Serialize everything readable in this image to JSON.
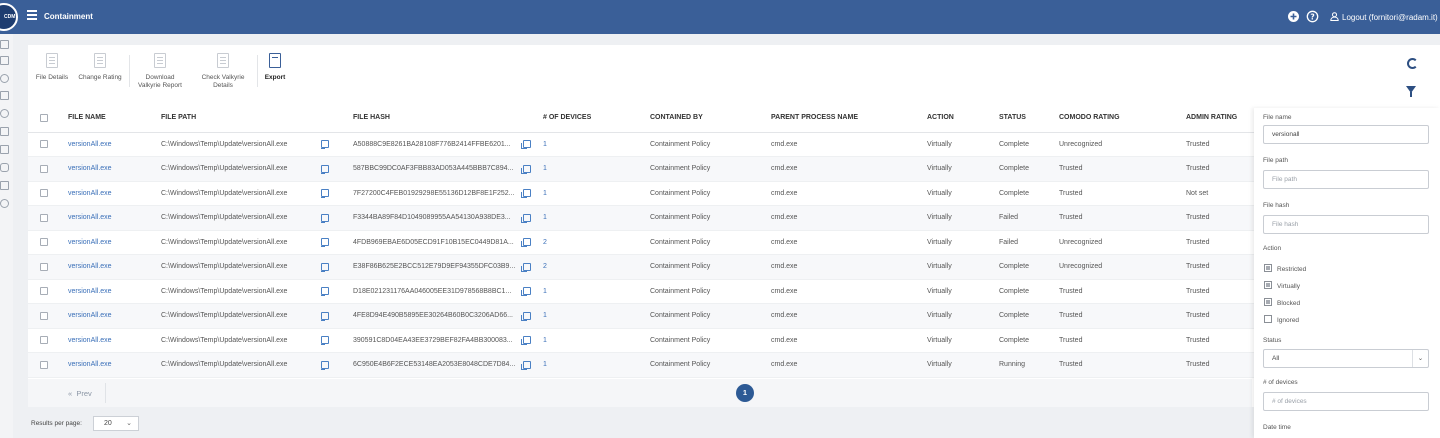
{
  "topbar": {
    "logo_text": "CDM",
    "title": "Containment",
    "logout_label": "Logout (fornitori@radam.it)"
  },
  "toolbar": {
    "file_details": "File Details",
    "change_rating": "Change Rating",
    "download_valkyrie_line1": "Download",
    "download_valkyrie_line2": "Valkyrie Report",
    "check_valkyrie_line1": "Check Valkyrie",
    "check_valkyrie_line2": "Details",
    "export": "Export"
  },
  "table": {
    "headers": {
      "file_name": "FILE NAME",
      "file_path": "FILE PATH",
      "file_hash": "FILE HASH",
      "devices": "# OF DEVICES",
      "contained_by": "CONTAINED BY",
      "parent_process": "PARENT PROCESS NAME",
      "action": "ACTION",
      "status": "STATUS",
      "comodo_rating": "COMODO RATING",
      "admin_rating": "ADMIN RATING"
    },
    "rows": [
      {
        "name": "versionAll.exe",
        "path": "C:\\Windows\\Temp\\Update\\versionAll.exe",
        "hash": "A50888C9E8261BA28108F776B2414FFBE6201...",
        "devices": "1",
        "contained_by": "Containment Policy",
        "parent": "cmd.exe",
        "action": "Virtually",
        "status": "Complete",
        "comodo": "Unrecognized",
        "admin": "Trusted"
      },
      {
        "name": "versionAll.exe",
        "path": "C:\\Windows\\Temp\\Update\\versionAll.exe",
        "hash": "587BBC99DC0AF3FBB83AD053A445BBB7C894...",
        "devices": "1",
        "contained_by": "Containment Policy",
        "parent": "cmd.exe",
        "action": "Virtually",
        "status": "Complete",
        "comodo": "Trusted",
        "admin": "Trusted"
      },
      {
        "name": "versionAll.exe",
        "path": "C:\\Windows\\Temp\\Update\\versionAll.exe",
        "hash": "7F27200C4FEB01929298E55136D12BF8E1F252...",
        "devices": "1",
        "contained_by": "Containment Policy",
        "parent": "cmd.exe",
        "action": "Virtually",
        "status": "Complete",
        "comodo": "Trusted",
        "admin": "Not set"
      },
      {
        "name": "versionAll.exe",
        "path": "C:\\Windows\\Temp\\Update\\versionAll.exe",
        "hash": "F3344BA89F84D1049089955AA54130A938DE3...",
        "devices": "1",
        "contained_by": "Containment Policy",
        "parent": "cmd.exe",
        "action": "Virtually",
        "status": "Failed",
        "comodo": "Trusted",
        "admin": "Trusted"
      },
      {
        "name": "versionAll.exe",
        "path": "C:\\Windows\\Temp\\Update\\versionAll.exe",
        "hash": "4FDB969EBAE6D05ECD91F10B15EC0449D81A...",
        "devices": "2",
        "contained_by": "Containment Policy",
        "parent": "cmd.exe",
        "action": "Virtually",
        "status": "Failed",
        "comodo": "Unrecognized",
        "admin": "Trusted"
      },
      {
        "name": "versionAll.exe",
        "path": "C:\\Windows\\Temp\\Update\\versionAll.exe",
        "hash": "E38F86B625E2BCC512E79D9EF94355DFC03B9...",
        "devices": "2",
        "contained_by": "Containment Policy",
        "parent": "cmd.exe",
        "action": "Virtually",
        "status": "Complete",
        "comodo": "Unrecognized",
        "admin": "Trusted"
      },
      {
        "name": "versionAll.exe",
        "path": "C:\\Windows\\Temp\\Update\\versionAll.exe",
        "hash": "D18E021231176AA046005EE31D978568B8BC1...",
        "devices": "1",
        "contained_by": "Containment Policy",
        "parent": "cmd.exe",
        "action": "Virtually",
        "status": "Complete",
        "comodo": "Trusted",
        "admin": "Trusted"
      },
      {
        "name": "versionAll.exe",
        "path": "C:\\Windows\\Temp\\Update\\versionAll.exe",
        "hash": "4FE8D94E490B5895EE30264B60B0C3206AD66...",
        "devices": "1",
        "contained_by": "Containment Policy",
        "parent": "cmd.exe",
        "action": "Virtually",
        "status": "Complete",
        "comodo": "Trusted",
        "admin": "Trusted"
      },
      {
        "name": "versionAll.exe",
        "path": "C:\\Windows\\Temp\\Update\\versionAll.exe",
        "hash": "390591C8D04EA43EE3729BEF82FA4BB300083...",
        "devices": "1",
        "contained_by": "Containment Policy",
        "parent": "cmd.exe",
        "action": "Virtually",
        "status": "Complete",
        "comodo": "Trusted",
        "admin": "Trusted"
      },
      {
        "name": "versionAll.exe",
        "path": "C:\\Windows\\Temp\\Update\\versionAll.exe",
        "hash": "6C950E4B6F2ECE53148EA2053E8048CDE7D84...",
        "devices": "1",
        "contained_by": "Containment Policy",
        "parent": "cmd.exe",
        "action": "Virtually",
        "status": "Running",
        "comodo": "Trusted",
        "admin": "Trusted"
      }
    ]
  },
  "pager": {
    "prev_label": "Prev",
    "current_page": "1"
  },
  "results_per_page": {
    "label": "Results per page:",
    "value": "20"
  },
  "filters": {
    "file_name_label": "File name",
    "file_name_value": "versionall",
    "file_path_label": "File path",
    "file_path_placeholder": "File path",
    "file_hash_label": "File hash",
    "file_hash_placeholder": "File hash",
    "action_label": "Action",
    "actions": [
      {
        "label": "Restricted",
        "checked": true
      },
      {
        "label": "Virtually",
        "checked": true
      },
      {
        "label": "Blocked",
        "checked": true
      },
      {
        "label": "Ignored",
        "checked": false
      }
    ],
    "status_label": "Status",
    "status_value": "All",
    "devices_label": "# of devices",
    "devices_placeholder": "# of devices",
    "datetime_label": "Date time"
  }
}
